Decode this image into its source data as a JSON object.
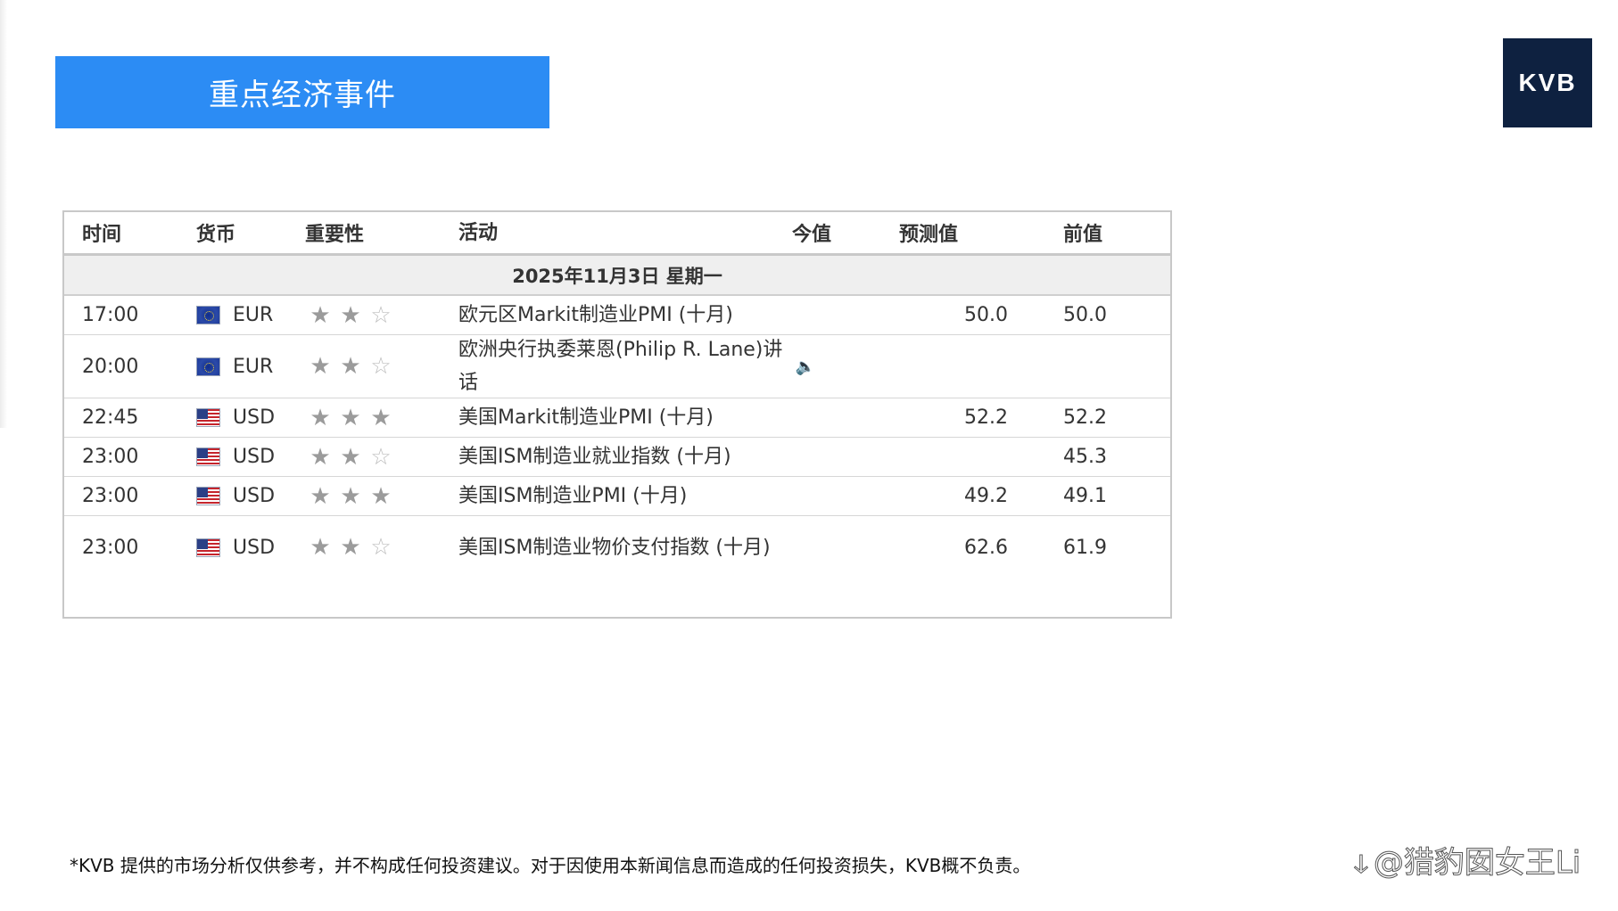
{
  "header": {
    "title": "重点经济事件"
  },
  "logo": {
    "text": "KVB"
  },
  "table": {
    "headers": {
      "time": "时间",
      "currency": "货币",
      "importance": "重要性",
      "event": "活动",
      "actual": "今值",
      "forecast": "预测值",
      "previous": "前值"
    },
    "date": "2025年11月3日  星期一",
    "rows": [
      {
        "time": "17:00",
        "flag": "eu-flag-icon",
        "currency": "EUR",
        "stars": 2,
        "event": "欧元区Markit制造业PMI (十月)",
        "actual": "",
        "forecast": "50.0",
        "previous": "50.0"
      },
      {
        "time": "20:00",
        "flag": "eu-flag-icon",
        "currency": "EUR",
        "stars": 2,
        "event": "欧洲央行执委莱恩(Philip R. Lane)讲话",
        "speaker": "speaker-icon",
        "actual": "",
        "forecast": "",
        "previous": ""
      },
      {
        "time": "22:45",
        "flag": "us-flag-icon",
        "currency": "USD",
        "stars": 3,
        "event": "美国Markit制造业PMI (十月)",
        "actual": "",
        "forecast": "52.2",
        "previous": "52.2"
      },
      {
        "time": "23:00",
        "flag": "us-flag-icon",
        "currency": "USD",
        "stars": 2,
        "event": "美国ISM制造业就业指数 (十月)",
        "actual": "",
        "forecast": "",
        "previous": "45.3"
      },
      {
        "time": "23:00",
        "flag": "us-flag-icon",
        "currency": "USD",
        "stars": 3,
        "event": "美国ISM制造业PMI (十月)",
        "actual": "",
        "forecast": "49.2",
        "previous": "49.1"
      },
      {
        "time": "23:00",
        "flag": "us-flag-icon",
        "currency": "USD",
        "stars": 2,
        "event": "美国ISM制造业物价支付指数 (十月)",
        "actual": "",
        "forecast": "62.6",
        "previous": "61.9"
      }
    ]
  },
  "disclaimer": "*KVB 提供的市场分析仅供参考，并不构成任何投资建议。对于因使用本新闻信息而造成的任何投资损失，KVB概不负责。",
  "watermark": "@猎豹囡女王Li"
}
